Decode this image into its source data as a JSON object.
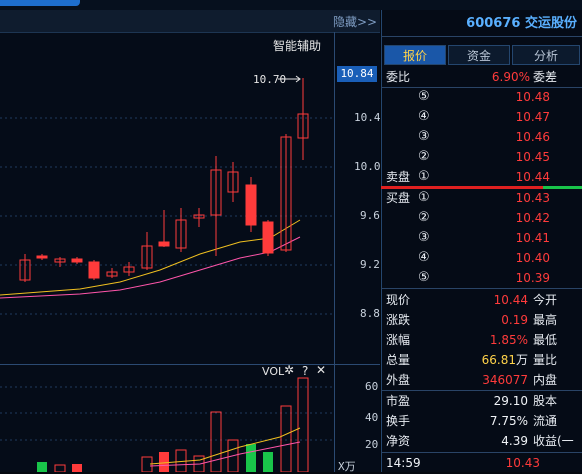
{
  "chart_header": {
    "hide_label": "隐藏>>"
  },
  "price_axis": {
    "current": "10.84",
    "ticks": [
      "10.4",
      "10.0",
      "9.6",
      "9.2",
      "8.8"
    ]
  },
  "aux": {
    "label": "智能辅助",
    "peak": "10.70"
  },
  "volume": {
    "label": "VOL",
    "gear": "✲",
    "help": "?",
    "close": "✕",
    "ticks": [
      "60",
      "40",
      "20"
    ],
    "unit": "X万"
  },
  "stock": {
    "code": "600676",
    "name": "交运股份"
  },
  "tabs": [
    "报价",
    "资金",
    "分析"
  ],
  "order_book": {
    "ratio_label": "委比",
    "ratio_value": "6.90%",
    "diff_label": "委差",
    "sell_label": "卖盘",
    "buy_label": "买盘",
    "sells": [
      {
        "level": "⑤",
        "price": "10.48"
      },
      {
        "level": "④",
        "price": "10.47"
      },
      {
        "level": "③",
        "price": "10.46"
      },
      {
        "level": "②",
        "price": "10.45"
      },
      {
        "level": "①",
        "price": "10.44"
      }
    ],
    "buys": [
      {
        "level": "①",
        "price": "10.43"
      },
      {
        "level": "②",
        "price": "10.42"
      },
      {
        "level": "③",
        "price": "10.41"
      },
      {
        "level": "④",
        "price": "10.40"
      },
      {
        "level": "⑤",
        "price": "10.39"
      }
    ]
  },
  "quote": {
    "now_label": "现价",
    "now": "10.44",
    "open_label": "今开",
    "chg_label": "涨跌",
    "chg": "0.19",
    "high_label": "最高",
    "pct_label": "涨幅",
    "pct": "1.85%",
    "low_label": "最低",
    "vol_label": "总量",
    "vol": "66.81",
    "vol_unit": "万",
    "vr_label": "量比",
    "outer_label": "外盘",
    "outer": "346077",
    "inner_label": "内盘",
    "pe_label": "市盈",
    "pe": "29.10",
    "cap_label": "股本",
    "turn_label": "换手",
    "turn": "7.75%",
    "float_label": "流通",
    "nav_label": "净资",
    "nav": "4.39",
    "eps_label": "收益(一",
    "time": "14:59",
    "tick_price": "10.43"
  },
  "colors": {
    "up": "#ff3b3b",
    "down": "#19c54a",
    "accent": "#1a57a8"
  }
}
